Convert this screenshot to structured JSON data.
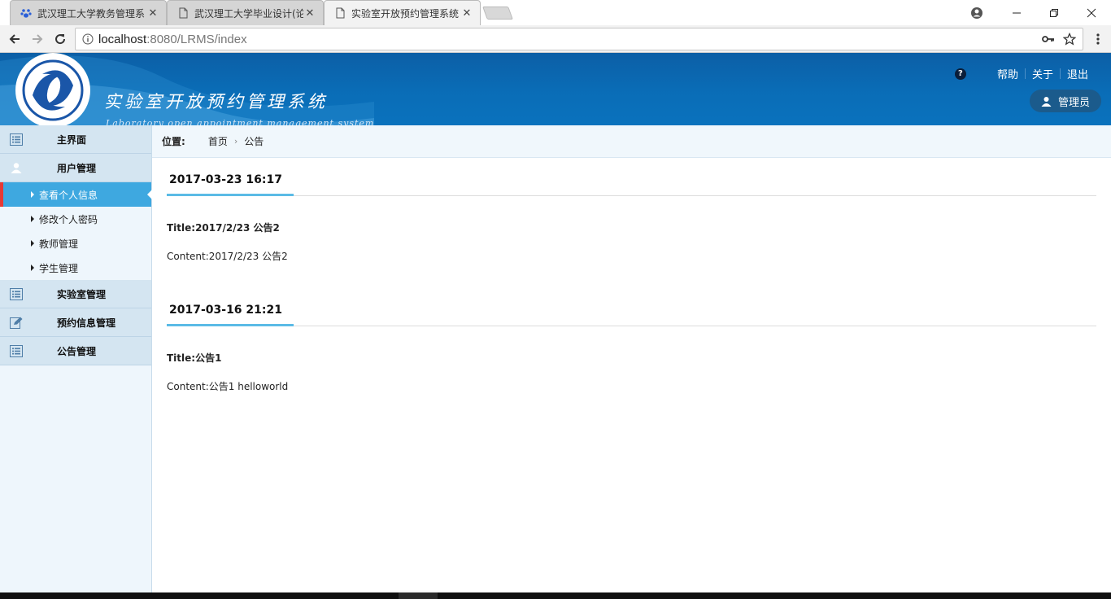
{
  "browser": {
    "tabs": [
      {
        "title": "武汉理工大学教务管理系",
        "active": false
      },
      {
        "title": "武汉理工大学毕业设计(论",
        "active": false
      },
      {
        "title": "实验室开放预约管理系统",
        "active": true
      }
    ],
    "url_host": "localhost",
    "url_rest": ":8080/LRMS/index"
  },
  "header": {
    "system_title": "实验室开放预约管理系统",
    "system_subtitle": "Laboratory open appointment management system",
    "links": [
      "帮助",
      "关于",
      "退出"
    ],
    "user_role": "管理员"
  },
  "sidebar": {
    "groups": [
      {
        "label": "主界面",
        "icon": "list-icon"
      },
      {
        "label": "用户管理",
        "icon": "user-icon",
        "items": [
          "查看个人信息",
          "修改个人密码",
          "教师管理",
          "学生管理"
        ],
        "active_item": 0
      },
      {
        "label": "实验室管理",
        "icon": "list-icon"
      },
      {
        "label": "预约信息管理",
        "icon": "edit-icon"
      },
      {
        "label": "公告管理",
        "icon": "list-icon"
      }
    ]
  },
  "breadcrumb": {
    "label": "位置:",
    "items": [
      "首页",
      "公告"
    ]
  },
  "notices": [
    {
      "date": "2017-03-23 16:17",
      "title": "Title:2017/2/23 公告2",
      "content": "Content:2017/2/23 公告2"
    },
    {
      "date": "2017-03-16 21:21",
      "title": "Title:公告1",
      "content": "Content:公告1 helloworld"
    }
  ],
  "colors": {
    "header_blue": "#0a6db7",
    "active_item": "#3ea8e0",
    "active_marker": "#e53935",
    "underline": "#5bbbe6"
  }
}
